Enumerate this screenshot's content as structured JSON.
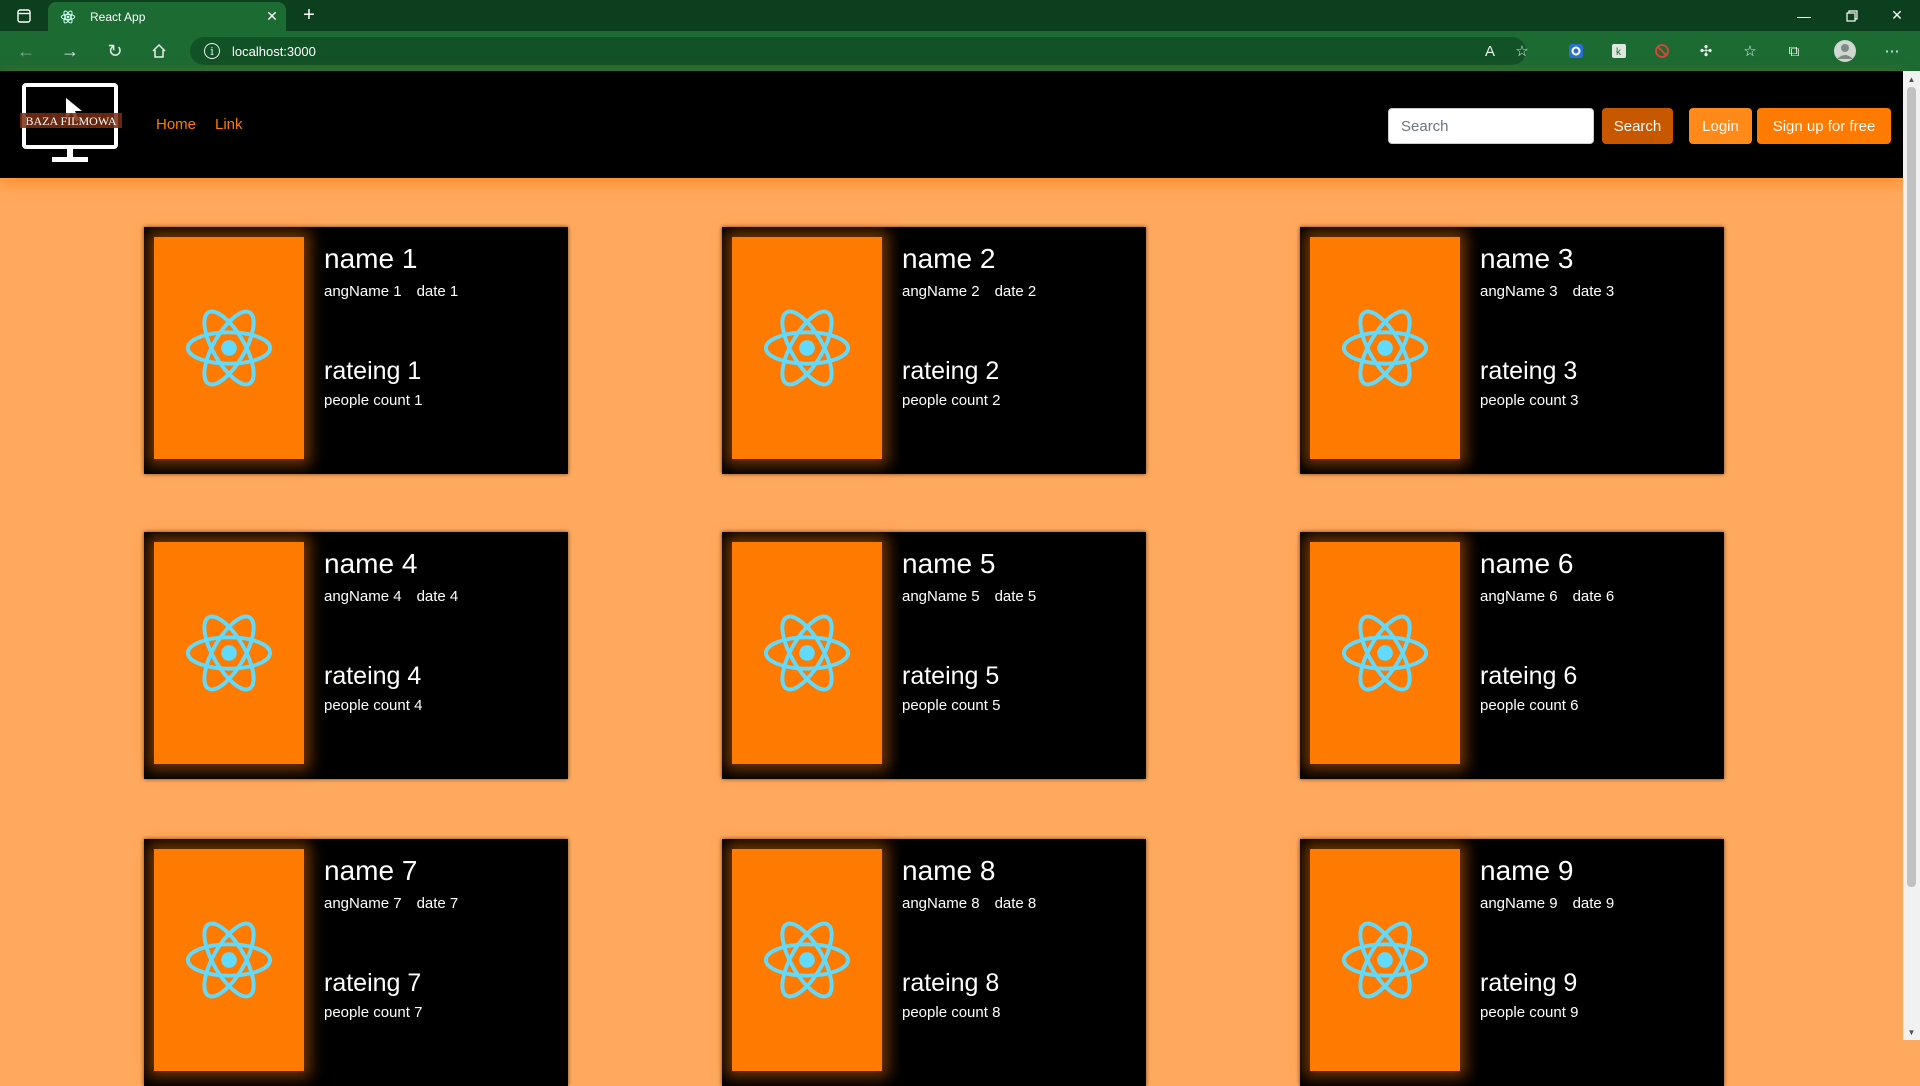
{
  "browser": {
    "tab_title": "React App",
    "url": "localhost:3000",
    "accent": "#1c6b33"
  },
  "navbar": {
    "logo_text": "BAZA FILMOWA",
    "links": [
      "Home",
      "Link"
    ],
    "search_placeholder": "Search",
    "search_button": "Search",
    "login_button": "Login",
    "signup_button": "Sign up for free"
  },
  "colors": {
    "page_background": "#ffa95e",
    "brand_orange": "#ff7a00",
    "card_background": "#000000",
    "react_logo": "#61dafb"
  },
  "movies": [
    {
      "name": "name 1",
      "angName": "angName 1",
      "date": "date 1",
      "rating": "rateing 1",
      "people": "people count 1"
    },
    {
      "name": "name 2",
      "angName": "angName 2",
      "date": "date 2",
      "rating": "rateing 2",
      "people": "people count 2"
    },
    {
      "name": "name 3",
      "angName": "angName 3",
      "date": "date 3",
      "rating": "rateing 3",
      "people": "people count 3"
    },
    {
      "name": "name 4",
      "angName": "angName 4",
      "date": "date 4",
      "rating": "rateing 4",
      "people": "people count 4"
    },
    {
      "name": "name 5",
      "angName": "angName 5",
      "date": "date 5",
      "rating": "rateing 5",
      "people": "people count 5"
    },
    {
      "name": "name 6",
      "angName": "angName 6",
      "date": "date 6",
      "rating": "rateing 6",
      "people": "people count 6"
    },
    {
      "name": "name 7",
      "angName": "angName 7",
      "date": "date 7",
      "rating": "rateing 7",
      "people": "people count 7"
    },
    {
      "name": "name 8",
      "angName": "angName 8",
      "date": "date 8",
      "rating": "rateing 8",
      "people": "people count 8"
    },
    {
      "name": "name 9",
      "angName": "angName 9",
      "date": "date 9",
      "rating": "rateing 9",
      "people": "people count 9"
    }
  ]
}
